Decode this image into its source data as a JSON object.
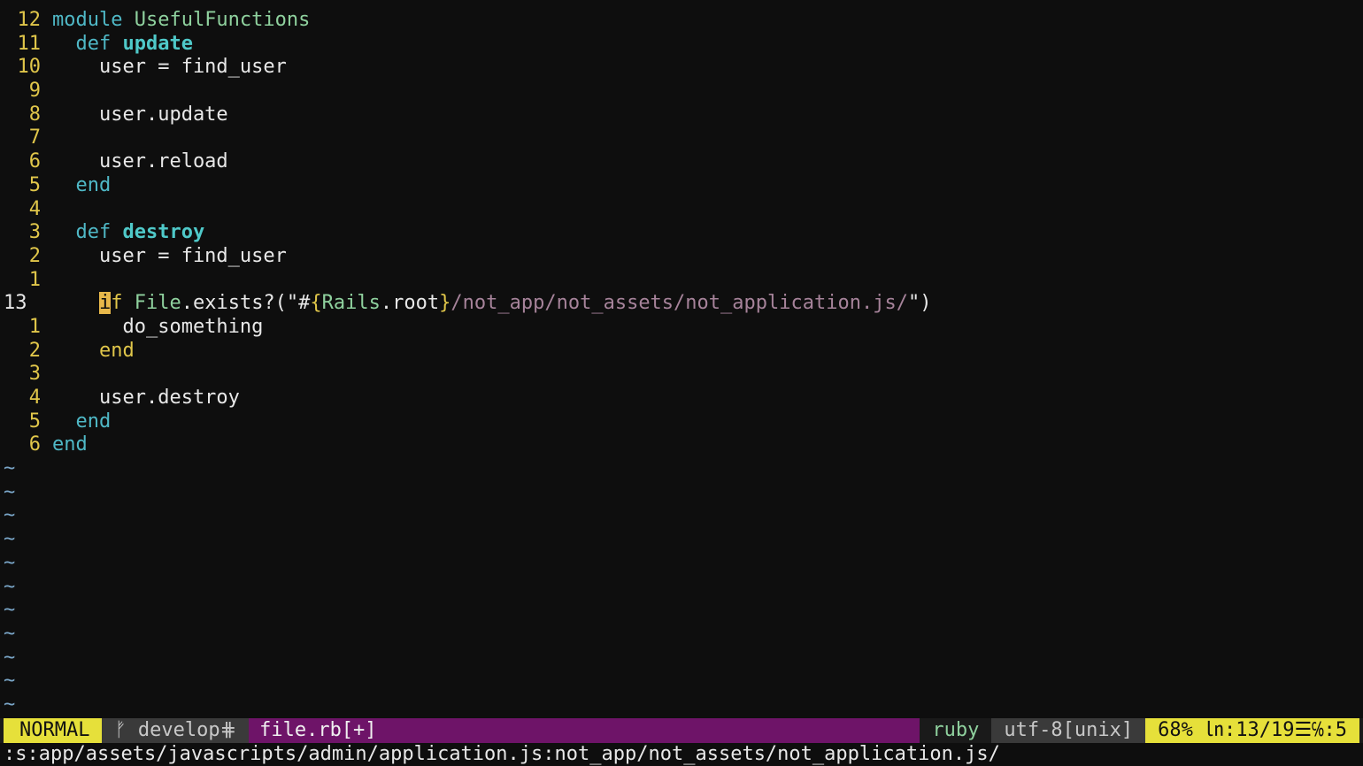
{
  "lines": [
    {
      "num": "12",
      "parts": [
        [
          "kw",
          "module "
        ],
        [
          "const",
          "UsefulFunctions"
        ]
      ]
    },
    {
      "num": "11",
      "parts": [
        [
          "plain",
          "  "
        ],
        [
          "kw",
          "def "
        ],
        [
          "fn",
          "update"
        ]
      ]
    },
    {
      "num": "10",
      "parts": [
        [
          "plain",
          "    user = find_user"
        ]
      ]
    },
    {
      "num": "9",
      "parts": []
    },
    {
      "num": "8",
      "parts": [
        [
          "plain",
          "    user.update"
        ]
      ]
    },
    {
      "num": "7",
      "parts": []
    },
    {
      "num": "6",
      "parts": [
        [
          "plain",
          "    user.reload"
        ]
      ]
    },
    {
      "num": "5",
      "parts": [
        [
          "plain",
          "  "
        ],
        [
          "kw",
          "end"
        ]
      ]
    },
    {
      "num": "4",
      "parts": []
    },
    {
      "num": "3",
      "parts": [
        [
          "plain",
          "  "
        ],
        [
          "kw",
          "def "
        ],
        [
          "fn",
          "destroy"
        ]
      ]
    },
    {
      "num": "2",
      "parts": [
        [
          "plain",
          "    user = find_user"
        ]
      ]
    },
    {
      "num": "1",
      "parts": []
    },
    {
      "num": "13",
      "current": true,
      "parts": [
        [
          "plain",
          "    "
        ],
        [
          "cursor",
          "i"
        ],
        [
          "end-y",
          "f "
        ],
        [
          "const",
          "File"
        ],
        [
          "plain",
          ".exists?(\"#"
        ],
        [
          "end-y",
          "{"
        ],
        [
          "interp",
          "Rails"
        ],
        [
          "plain",
          ".root"
        ],
        [
          "end-y",
          "}"
        ],
        [
          "str-path",
          "/not_app/not_assets/not_application.js/"
        ],
        [
          "plain",
          "\")"
        ]
      ]
    },
    {
      "num": "1",
      "parts": [
        [
          "plain",
          "      do_something"
        ]
      ]
    },
    {
      "num": "2",
      "parts": [
        [
          "plain",
          "    "
        ],
        [
          "end-y",
          "end"
        ]
      ]
    },
    {
      "num": "3",
      "parts": []
    },
    {
      "num": "4",
      "parts": [
        [
          "plain",
          "    user.destroy"
        ]
      ]
    },
    {
      "num": "5",
      "parts": [
        [
          "plain",
          "  "
        ],
        [
          "kw",
          "end"
        ]
      ]
    },
    {
      "num": "6",
      "parts": [
        [
          "kw",
          "end"
        ]
      ]
    }
  ],
  "tilde_char": "~",
  "tilde_count": 11,
  "status": {
    "mode": "NORMAL",
    "branch": "ᚠ develop⋕",
    "file": "file.rb[+]",
    "filetype": "ruby",
    "encoding": "utf-8[unix]",
    "position": "68% ㏑:13/19☰℅:5"
  },
  "command_line": ":s:app/assets/javascripts/admin/application.js:not_app/not_assets/not_application.js/"
}
